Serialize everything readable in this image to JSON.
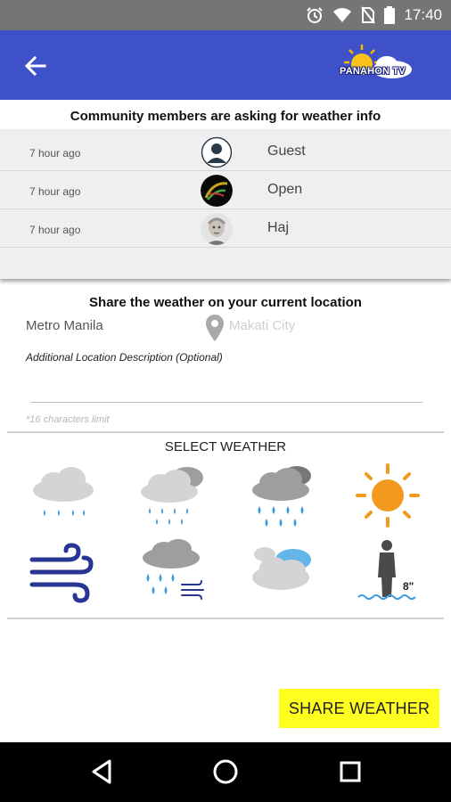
{
  "status_bar": {
    "time": "17:40",
    "icons": [
      "alarm-icon",
      "wifi-icon",
      "no-sim-icon",
      "battery-icon"
    ]
  },
  "app_bar": {
    "logo_text": "PANAHON TV",
    "back_icon": "arrow-left-icon",
    "color": "#3f51c8"
  },
  "community": {
    "title": "Community members are asking for weather info",
    "requests": [
      {
        "time_ago": "7 hour ago",
        "name": "Guest",
        "avatar": "guest-avatar"
      },
      {
        "time_ago": "7 hour ago",
        "name": "Open",
        "avatar": "open-avatar"
      },
      {
        "time_ago": "7 hour ago",
        "name": "Haj",
        "avatar": "haj-avatar"
      }
    ]
  },
  "share": {
    "title": "Share the weather on your current location",
    "region": "Metro Manila",
    "city": "Makati City",
    "description_label": "Additional Location Description (Optional)",
    "description_value": "",
    "char_limit": "*16 characters limit",
    "select_title": "SELECT WEATHER",
    "weather_options": [
      "light-rain-icon",
      "cloudy-light-rain-icon",
      "cloudy-rain-icon",
      "sunny-icon",
      "windy-icon",
      "rain-wind-icon",
      "cloudy-icon",
      "flood-icon"
    ],
    "flood_level": "8\"",
    "button_label": "SHARE WEATHER",
    "button_color": "#ffff1f"
  },
  "nav_bar": {
    "icons": [
      "back-triangle-icon",
      "home-circle-icon",
      "recents-square-icon"
    ]
  }
}
